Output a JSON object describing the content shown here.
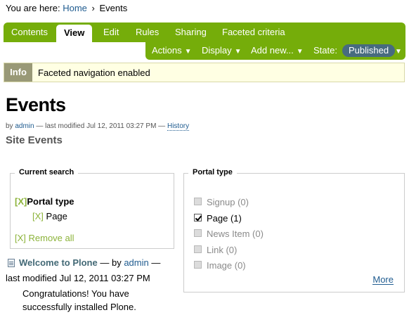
{
  "breadcrumbs": {
    "prefix": "You are here:",
    "home": "Home",
    "separator": "›",
    "current": "Events"
  },
  "tabs": [
    "Contents",
    "View",
    "Edit",
    "Rules",
    "Sharing",
    "Faceted criteria"
  ],
  "active_tab": "View",
  "menus": {
    "actions": "Actions",
    "display": "Display",
    "add_new": "Add new...",
    "state_label": "State:",
    "state_value": "Published",
    "arrow": "▼"
  },
  "info": {
    "label": "Info",
    "message": "Faceted navigation enabled"
  },
  "page": {
    "title": "Events",
    "byline_by": "by",
    "author": "admin",
    "byline_modified": "— last modified Jul 12, 2011 03:27 PM —",
    "history": "History",
    "description": "Site Events"
  },
  "current_search": {
    "legend": "Current search",
    "remove_marker": "[X]",
    "criterion": "Portal type",
    "value": "Page",
    "remove_all": "[X] Remove all"
  },
  "portal_type": {
    "legend": "Portal type",
    "options": [
      {
        "label": "Signup (0)",
        "checked": false
      },
      {
        "label": "Page (1)",
        "checked": true
      },
      {
        "label": "News Item (0)",
        "checked": false
      },
      {
        "label": "Link (0)",
        "checked": false
      },
      {
        "label": "Image (0)",
        "checked": false
      }
    ],
    "more": "More"
  },
  "result": {
    "title": "Welcome to Plone",
    "by": "— by",
    "author": "admin",
    "dash": "—",
    "modified": "last modified Jul 12, 2011 03:27 PM",
    "description": "Congratulations! You have successfully installed Plone."
  }
}
